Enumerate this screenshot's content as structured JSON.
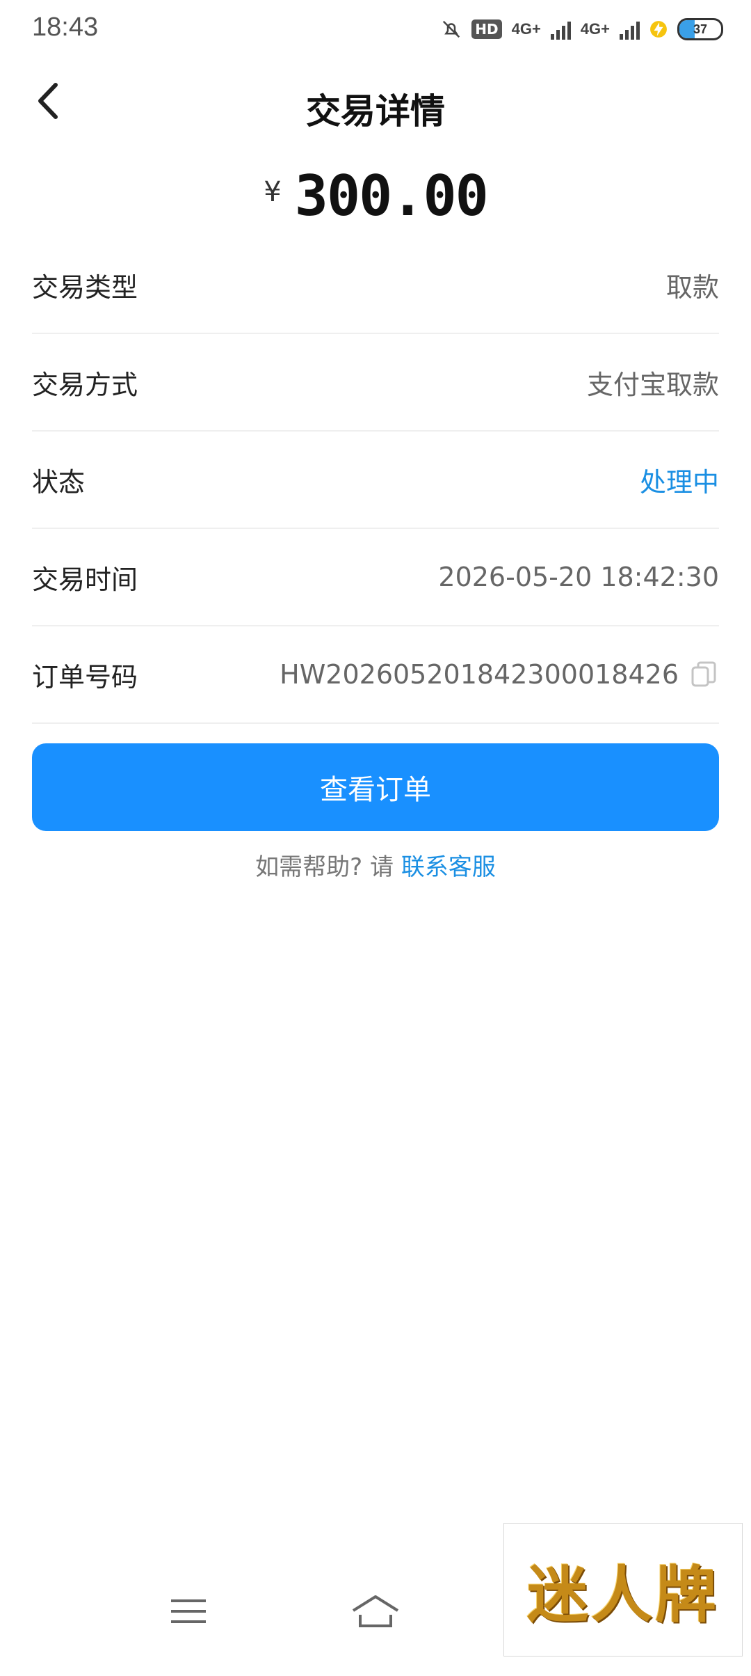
{
  "status_bar": {
    "time": "18:43",
    "hd_label": "HD",
    "network_1": "4G+",
    "network_2": "4G+",
    "battery_level": "37"
  },
  "header": {
    "title": "交易详情"
  },
  "amount": {
    "currency": "¥",
    "value": "300.00"
  },
  "details": [
    {
      "label": "交易类型",
      "value": "取款"
    },
    {
      "label": "交易方式",
      "value": "支付宝取款"
    },
    {
      "label": "状态",
      "value": "处理中"
    },
    {
      "label": "交易时间",
      "value": "2026-05-20 18:42:30"
    },
    {
      "label": "订单号码",
      "value": "HW20260520184230001842​6"
    }
  ],
  "primary_button": {
    "label": "查看订单"
  },
  "help": {
    "prefix": "如需帮助? 请 ",
    "link": "联系客服"
  },
  "watermark": {
    "text": "迷人牌"
  },
  "colors": {
    "accent": "#1a8fe3",
    "button": "#1990ff"
  }
}
